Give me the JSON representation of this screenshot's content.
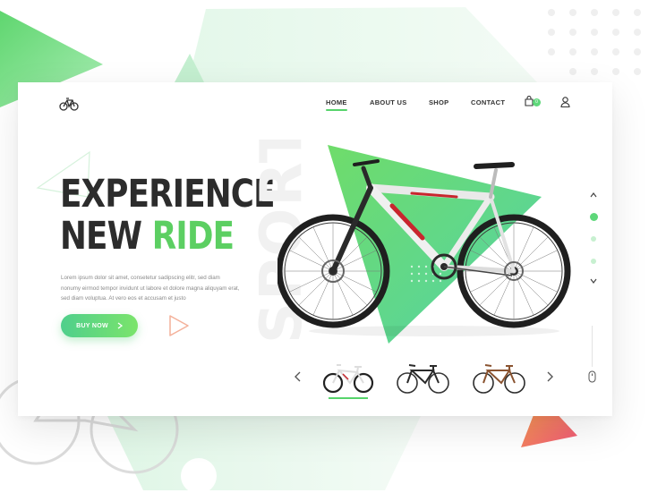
{
  "brand": {
    "logo_icon": "bicycle-logo-icon"
  },
  "nav": {
    "items": [
      {
        "label": "HOME",
        "active": true
      },
      {
        "label": "ABOUT US",
        "active": false
      },
      {
        "label": "SHOP",
        "active": false
      },
      {
        "label": "CONTACT",
        "active": false
      }
    ],
    "cart_icon": "shopping-bag-icon",
    "cart_count": "0",
    "user_icon": "user-icon"
  },
  "hero": {
    "headline_line1": "EXPERIENCE",
    "headline_line2_plain": "NEW ",
    "headline_line2_accent": "RIDE",
    "description": "Lorem ipsum dolor sit amet, consetetur sadipscing elitr, sed diam nonumy eirmod tempor invidunt ut labore et dolore magna aliquyam erat, sed diam voluptua. At vero eos et accusam et justo",
    "cta_label": "BUY NOW",
    "cta_icon": "chevron-right-icon",
    "play_icon": "play-icon",
    "background_word": "SPORT",
    "product_image": "mountain-bike-white-red"
  },
  "carousel": {
    "prev_icon": "chevron-left-icon",
    "next_icon": "chevron-right-icon",
    "thumbnails": [
      {
        "name": "white-mountain-bike",
        "selected": true
      },
      {
        "name": "black-road-bike",
        "selected": false
      },
      {
        "name": "brown-road-bike",
        "selected": false
      }
    ]
  },
  "side_nav": {
    "up_icon": "chevron-up-icon",
    "down_icon": "chevron-down-icon",
    "dots": 3,
    "active_dot": 1,
    "scroll_icon": "mouse-icon"
  },
  "colors": {
    "accent": "#5ccf62",
    "accent_teal": "#4fcf8c",
    "text_dark": "#2c2c2c",
    "text_muted": "#8a8a8a",
    "orange_triangle": "#f5694a"
  }
}
